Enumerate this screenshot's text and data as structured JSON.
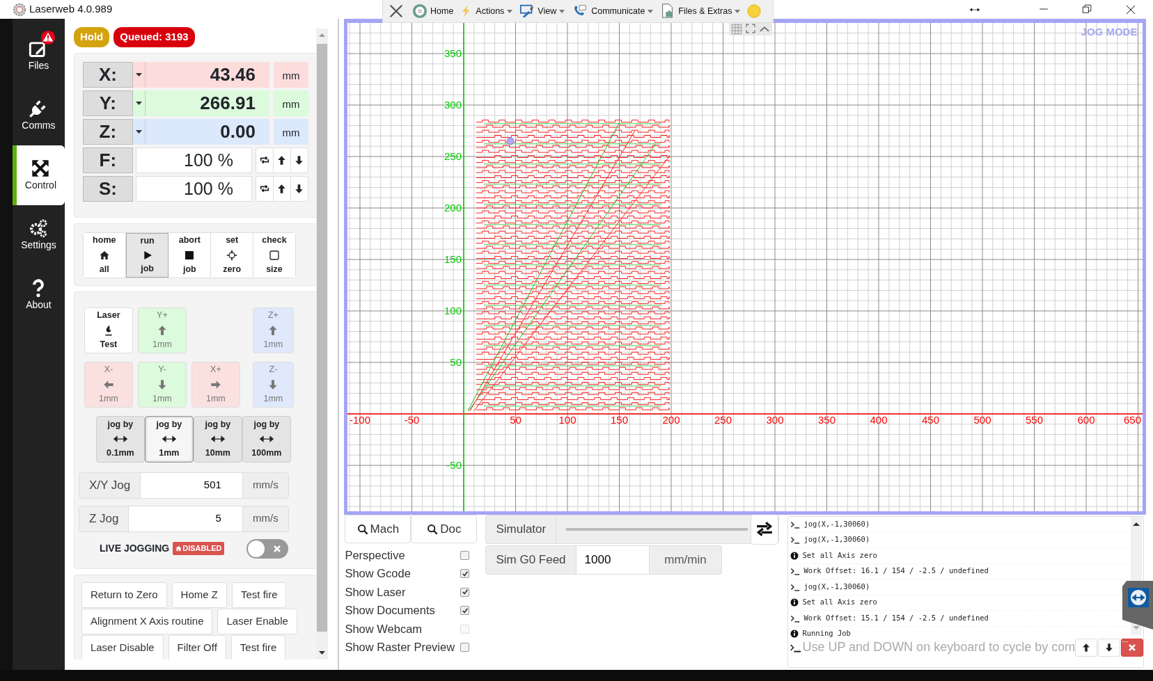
{
  "window": {
    "title": "Laserweb 4.0.989"
  },
  "toolbar": {
    "items": [
      {
        "kind": "home",
        "label": "Home",
        "dropdown": false
      },
      {
        "kind": "actions",
        "label": "Actions",
        "dropdown": true
      },
      {
        "kind": "view",
        "label": "View",
        "dropdown": true
      },
      {
        "kind": "communicate",
        "label": "Communicate",
        "dropdown": true
      },
      {
        "kind": "files",
        "label": "Files & Extras",
        "dropdown": true
      }
    ]
  },
  "sidebar": {
    "items": [
      {
        "kind": "files",
        "label": "Files",
        "selected": false,
        "alert": true
      },
      {
        "kind": "comms",
        "label": "Comms",
        "selected": false,
        "alert": false
      },
      {
        "kind": "control",
        "label": "Control",
        "selected": true,
        "alert": false
      },
      {
        "kind": "settings",
        "label": "Settings",
        "selected": false,
        "alert": false
      },
      {
        "kind": "about",
        "label": "About",
        "selected": false,
        "alert": false
      }
    ]
  },
  "status_badges": [
    {
      "label": "Hold",
      "color": "#d4a20c"
    },
    {
      "label": "Queued: 3193",
      "color": "#d9000d"
    }
  ],
  "axes": [
    {
      "label": "X:",
      "value": "43.46",
      "unit": "mm",
      "color": "#fddcdc"
    },
    {
      "label": "Y:",
      "value": "266.91",
      "unit": "mm",
      "color": "#dcfadc"
    },
    {
      "label": "Z:",
      "value": "0.00",
      "unit": "mm",
      "color": "#dce8fb"
    }
  ],
  "overrides": [
    {
      "label": "F:",
      "value": "100 %"
    },
    {
      "label": "S:",
      "value": "100 %"
    }
  ],
  "job_buttons": [
    {
      "kind": "home",
      "top": "home",
      "bottom": "all",
      "selected": false
    },
    {
      "kind": "run",
      "top": "run",
      "bottom": "job",
      "selected": true
    },
    {
      "kind": "abort",
      "top": "abort",
      "bottom": "job",
      "selected": false
    },
    {
      "kind": "zero",
      "top": "set",
      "bottom": "zero",
      "selected": false
    },
    {
      "kind": "check",
      "top": "check",
      "bottom": "size",
      "selected": false
    }
  ],
  "jog_pad": {
    "rows": [
      [
        {
          "kind": "laser",
          "top": "Laser",
          "bottom": "Test",
          "color": "#ffffff"
        },
        {
          "kind": "up",
          "top": "Y+",
          "bottom": "1mm",
          "color": "#dcfadc"
        },
        "",
        {
          "kind": "up",
          "top": "Z+",
          "bottom": "1mm",
          "color": "#e0e9fb"
        }
      ],
      [
        {
          "kind": "left",
          "top": "X-",
          "bottom": "1mm",
          "color": "#fbe0e0"
        },
        {
          "kind": "down",
          "top": "Y-",
          "bottom": "1mm",
          "color": "#dcfadc"
        },
        {
          "kind": "right",
          "top": "X+",
          "bottom": "1mm",
          "color": "#fbe0e0"
        },
        {
          "kind": "down",
          "top": "Z-",
          "bottom": "1mm",
          "color": "#e0e9fb"
        }
      ]
    ]
  },
  "jog_steps": [
    {
      "top": "jog by",
      "step": "0.1mm",
      "selected": false
    },
    {
      "top": "jog by",
      "step": "1mm",
      "selected": true
    },
    {
      "top": "jog by",
      "step": "10mm",
      "selected": false
    },
    {
      "top": "jog by",
      "step": "100mm",
      "selected": false
    }
  ],
  "jog_speeds": [
    {
      "label": "X/Y Jog",
      "value": "501",
      "unit": "mm/s"
    },
    {
      "label": "Z Jog",
      "value": "5",
      "unit": "mm/s"
    }
  ],
  "live_jogging": {
    "label": "LIVE JOGGING",
    "badge": "DISABLED",
    "on": false
  },
  "macros": [
    "Return to Zero",
    "Home Z",
    "Test fire",
    "Alignment X Axis routine",
    "Laser Enable",
    "Laser Disable",
    "Filter Off",
    "Test fire"
  ],
  "canvas": {
    "mode_label": "JOG MODE",
    "x_labels": [
      "-100",
      "-50",
      "50",
      "100",
      "150",
      "200",
      "250",
      "300",
      "350",
      "400",
      "450",
      "500",
      "550",
      "600",
      "650"
    ],
    "y_labels": [
      "350",
      "300",
      "250",
      "200",
      "150",
      "100",
      "50",
      "-50"
    ]
  },
  "view_buttons": [
    "Mach",
    "Doc"
  ],
  "view_options": [
    {
      "label": "Perspective",
      "checked": false,
      "disabled": false
    },
    {
      "label": "Show Gcode",
      "checked": true,
      "disabled": false
    },
    {
      "label": "Show Laser",
      "checked": true,
      "disabled": false
    },
    {
      "label": "Show Documents",
      "checked": true,
      "disabled": false
    },
    {
      "label": "Show Webcam",
      "checked": false,
      "disabled": true
    },
    {
      "label": "Show Raster Preview",
      "checked": false,
      "disabled": false
    }
  ],
  "simulator": {
    "label": "Simulator",
    "level": 1
  },
  "sim_feed": {
    "label": "Sim G0 Feed",
    "value": "1000",
    "unit": "mm/min"
  },
  "console": {
    "lines": [
      {
        "kind": "command",
        "text": "jog(X,-1,30060)"
      },
      {
        "kind": "command",
        "text": "jog(X,-1,30060)"
      },
      {
        "kind": "info",
        "text": "Set all Axis zero"
      },
      {
        "kind": "command",
        "text": "Work Offset: 16.1 / 154 / -2.5 / undefined"
      },
      {
        "kind": "command",
        "text": "jog(X,-1,30060)"
      },
      {
        "kind": "info",
        "text": "Set all Axis zero"
      },
      {
        "kind": "command",
        "text": "Work Offset: 15.1 / 154 / -2.5 / undefined"
      },
      {
        "kind": "info",
        "text": "Running Job"
      }
    ],
    "placeholder": "Use UP and DOWN on keyboard to cycle by com"
  }
}
